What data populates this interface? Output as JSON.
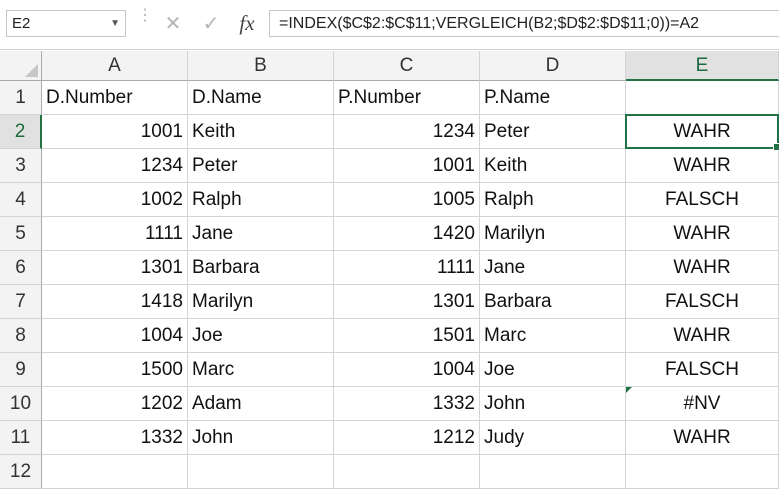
{
  "name_box": "E2",
  "formula": "=INDEX($C$2:$C$11;VERGLEICH(B2;$D$2:$D$11;0))=A2",
  "columns": [
    "A",
    "B",
    "C",
    "D",
    "E"
  ],
  "rows": [
    {
      "n": "1",
      "a": "D.Number",
      "b": "D.Name",
      "c": "P.Number",
      "d": "P.Name",
      "e": ""
    },
    {
      "n": "2",
      "a": "1001",
      "b": "Keith",
      "c": "1234",
      "d": "Peter",
      "e": "WAHR"
    },
    {
      "n": "3",
      "a": "1234",
      "b": "Peter",
      "c": "1001",
      "d": "Keith",
      "e": "WAHR"
    },
    {
      "n": "4",
      "a": "1002",
      "b": "Ralph",
      "c": "1005",
      "d": "Ralph",
      "e": "FALSCH"
    },
    {
      "n": "5",
      "a": "1111",
      "b": "Jane",
      "c": "1420",
      "d": "Marilyn",
      "e": "WAHR"
    },
    {
      "n": "6",
      "a": "1301",
      "b": "Barbara",
      "c": "1111",
      "d": "Jane",
      "e": "WAHR"
    },
    {
      "n": "7",
      "a": "1418",
      "b": "Marilyn",
      "c": "1301",
      "d": "Barbara",
      "e": "FALSCH"
    },
    {
      "n": "8",
      "a": "1004",
      "b": "Joe",
      "c": "1501",
      "d": "Marc",
      "e": "WAHR"
    },
    {
      "n": "9",
      "a": "1500",
      "b": "Marc",
      "c": "1004",
      "d": "Joe",
      "e": "FALSCH"
    },
    {
      "n": "10",
      "a": "1202",
      "b": "Adam",
      "c": "1332",
      "d": "John",
      "e": "#NV"
    },
    {
      "n": "11",
      "a": "1332",
      "b": "John",
      "c": "1212",
      "d": "Judy",
      "e": "WAHR"
    },
    {
      "n": "12",
      "a": "",
      "b": "",
      "c": "",
      "d": "",
      "e": ""
    }
  ],
  "icons": {
    "cancel": "cancel-icon",
    "enter": "checkmark-icon",
    "function": "fx-icon",
    "dropdown": "chevron-down-icon"
  },
  "colors": {
    "accent": "#217346",
    "header_bg": "#f3f3f3",
    "gridline": "#d4d4d4"
  },
  "active_cell": {
    "column": "E",
    "row": "2"
  }
}
